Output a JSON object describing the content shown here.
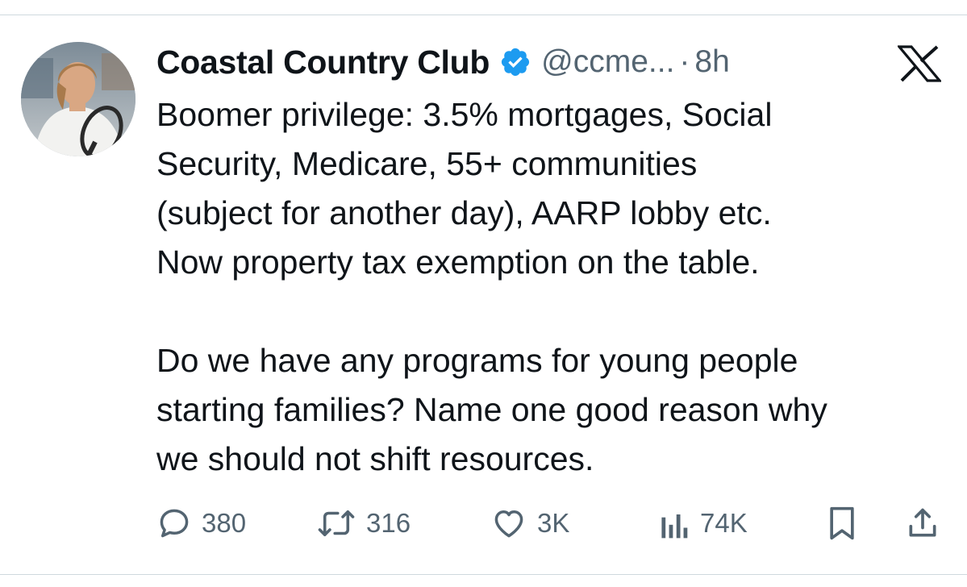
{
  "tweet": {
    "display_name": "Coastal Country Club",
    "handle": "@ccme...",
    "separator": "·",
    "time": "8h",
    "text_lines": [
      "Boomer privilege: 3.5% mortgages, Social",
      "Security, Medicare, 55+ communities",
      "(subject for another day), AARP lobby etc.",
      "Now property tax exemption on the table.",
      "Do we have any programs for young people",
      "starting families?  Name one good reason why",
      "we should not shift resources."
    ]
  },
  "actions": {
    "replies": "380",
    "retweets": "316",
    "likes": "3K",
    "views": "74K"
  },
  "icons": {
    "reply": "speech-bubble-icon",
    "retweet": "retweet-arrows-icon",
    "like": "heart-outline-icon",
    "views": "bar-chart-icon",
    "bookmark": "bookmark-icon",
    "share": "share-upload-icon",
    "verified": "verified-badge-icon",
    "platform": "x-logo-icon"
  },
  "colors": {
    "text": "#0f1419",
    "secondary": "#536471",
    "verified": "#1d9bf0",
    "divider": "#cfd9de"
  }
}
